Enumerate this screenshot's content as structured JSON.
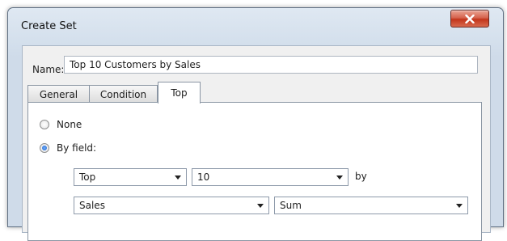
{
  "window": {
    "title": "Create Set",
    "close_icon": "close-x-icon"
  },
  "name": {
    "label": "Name:",
    "value": "Top 10 Customers by Sales"
  },
  "tabs": [
    {
      "label": "General",
      "active": false
    },
    {
      "label": "Condition",
      "active": false
    },
    {
      "label": "Top",
      "active": true
    }
  ],
  "top_tab": {
    "option_none": "None",
    "option_by_field": "By field:",
    "selected_option": "By field:",
    "direction": "Top",
    "count": "10",
    "by_label": "by",
    "field": "Sales",
    "aggregation": "Sum"
  }
}
